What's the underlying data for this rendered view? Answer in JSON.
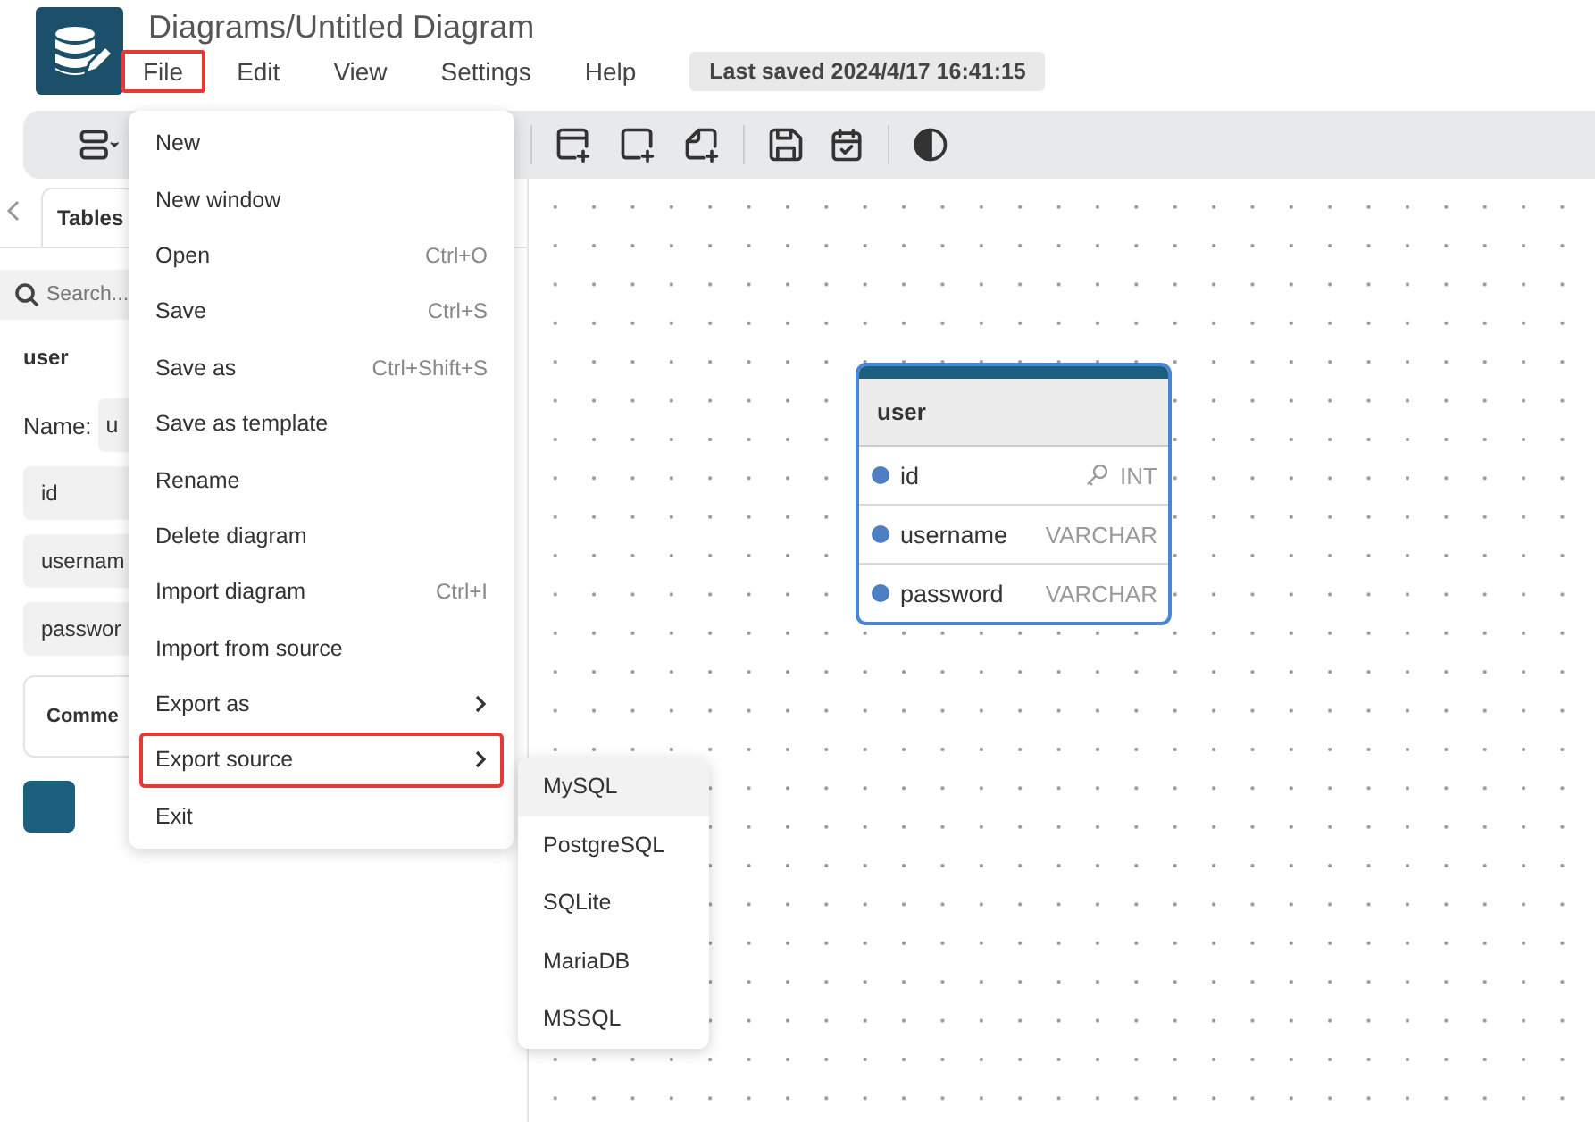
{
  "app": {
    "title": "Diagrams/Untitled Diagram"
  },
  "menubar": [
    {
      "label": "File",
      "highlighted": true
    },
    {
      "label": "Edit",
      "highlighted": false
    },
    {
      "label": "View",
      "highlighted": false
    },
    {
      "label": "Settings",
      "highlighted": false
    },
    {
      "label": "Help",
      "highlighted": false
    }
  ],
  "last_saved": "Last saved 2024/4/17 16:41:15",
  "sidebar": {
    "tabs": [
      {
        "label": "Tables",
        "selected": true
      }
    ],
    "search": {
      "placeholder": "Search..."
    },
    "table_name": "user",
    "name_label": "Name:",
    "name_value": "u",
    "fields": [
      "id",
      "usernam",
      "passwor"
    ],
    "comment": "Comme",
    "color": "#1b5e7e"
  },
  "file_menu": [
    {
      "label": "New",
      "kind": "item",
      "highlighted": false
    },
    {
      "label": "New window",
      "kind": "item",
      "highlighted": false
    },
    {
      "label": "Open",
      "kind": "item",
      "shortcut": "Ctrl+O",
      "highlighted": false
    },
    {
      "label": "Save",
      "kind": "item",
      "shortcut": "Ctrl+S",
      "highlighted": false
    },
    {
      "label": "Save as",
      "kind": "item",
      "shortcut": "Ctrl+Shift+S",
      "highlighted": false
    },
    {
      "label": "Save as template",
      "kind": "item",
      "highlighted": false
    },
    {
      "label": "Rename",
      "kind": "item",
      "highlighted": false
    },
    {
      "label": "Delete diagram",
      "kind": "item",
      "highlighted": false
    },
    {
      "label": "Import diagram",
      "kind": "item",
      "shortcut": "Ctrl+I",
      "highlighted": false
    },
    {
      "label": "Import from source",
      "kind": "item",
      "highlighted": false
    },
    {
      "label": "Export as",
      "kind": "submenu",
      "highlighted": false
    },
    {
      "label": "Export source",
      "kind": "submenu",
      "highlighted": true
    },
    {
      "label": "Exit",
      "kind": "item",
      "highlighted": false
    }
  ],
  "export_submenu": [
    {
      "label": "MySQL",
      "selected": true
    },
    {
      "label": "PostgreSQL",
      "selected": false
    },
    {
      "label": "SQLite",
      "selected": false
    },
    {
      "label": "MariaDB",
      "selected": false
    },
    {
      "label": "MSSQL",
      "selected": false
    }
  ],
  "diagram": {
    "tables": [
      {
        "name": "user",
        "color": "#1b5e7e",
        "fields": [
          {
            "name": "id",
            "type": "INT",
            "primary": true
          },
          {
            "name": "username",
            "type": "VARCHAR",
            "primary": false
          },
          {
            "name": "password",
            "type": "VARCHAR",
            "primary": false
          }
        ]
      }
    ]
  }
}
